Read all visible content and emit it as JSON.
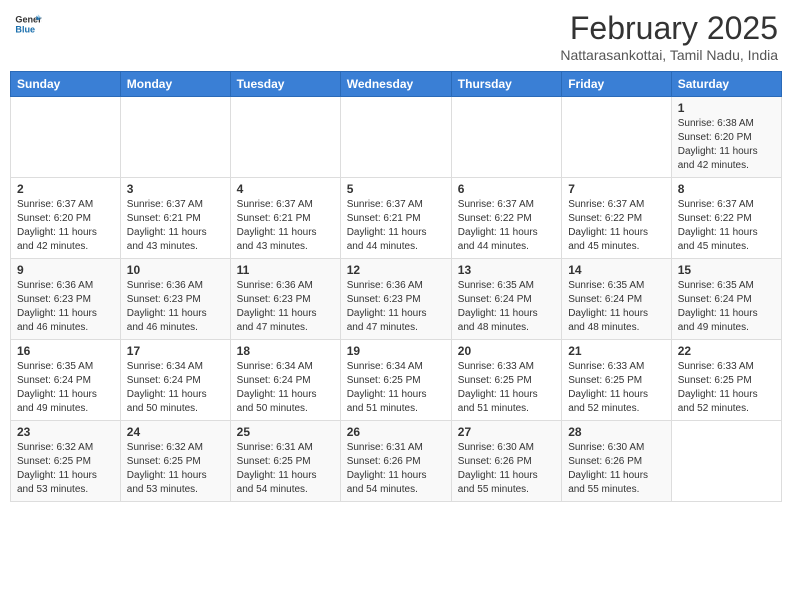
{
  "header": {
    "logo_line1": "General",
    "logo_line2": "Blue",
    "month_title": "February 2025",
    "location": "Nattarasankottai, Tamil Nadu, India"
  },
  "days_of_week": [
    "Sunday",
    "Monday",
    "Tuesday",
    "Wednesday",
    "Thursday",
    "Friday",
    "Saturday"
  ],
  "weeks": [
    [
      {
        "num": "",
        "info": ""
      },
      {
        "num": "",
        "info": ""
      },
      {
        "num": "",
        "info": ""
      },
      {
        "num": "",
        "info": ""
      },
      {
        "num": "",
        "info": ""
      },
      {
        "num": "",
        "info": ""
      },
      {
        "num": "1",
        "info": "Sunrise: 6:38 AM\nSunset: 6:20 PM\nDaylight: 11 hours\nand 42 minutes."
      }
    ],
    [
      {
        "num": "2",
        "info": "Sunrise: 6:37 AM\nSunset: 6:20 PM\nDaylight: 11 hours\nand 42 minutes."
      },
      {
        "num": "3",
        "info": "Sunrise: 6:37 AM\nSunset: 6:21 PM\nDaylight: 11 hours\nand 43 minutes."
      },
      {
        "num": "4",
        "info": "Sunrise: 6:37 AM\nSunset: 6:21 PM\nDaylight: 11 hours\nand 43 minutes."
      },
      {
        "num": "5",
        "info": "Sunrise: 6:37 AM\nSunset: 6:21 PM\nDaylight: 11 hours\nand 44 minutes."
      },
      {
        "num": "6",
        "info": "Sunrise: 6:37 AM\nSunset: 6:22 PM\nDaylight: 11 hours\nand 44 minutes."
      },
      {
        "num": "7",
        "info": "Sunrise: 6:37 AM\nSunset: 6:22 PM\nDaylight: 11 hours\nand 45 minutes."
      },
      {
        "num": "8",
        "info": "Sunrise: 6:37 AM\nSunset: 6:22 PM\nDaylight: 11 hours\nand 45 minutes."
      }
    ],
    [
      {
        "num": "9",
        "info": "Sunrise: 6:36 AM\nSunset: 6:23 PM\nDaylight: 11 hours\nand 46 minutes."
      },
      {
        "num": "10",
        "info": "Sunrise: 6:36 AM\nSunset: 6:23 PM\nDaylight: 11 hours\nand 46 minutes."
      },
      {
        "num": "11",
        "info": "Sunrise: 6:36 AM\nSunset: 6:23 PM\nDaylight: 11 hours\nand 47 minutes."
      },
      {
        "num": "12",
        "info": "Sunrise: 6:36 AM\nSunset: 6:23 PM\nDaylight: 11 hours\nand 47 minutes."
      },
      {
        "num": "13",
        "info": "Sunrise: 6:35 AM\nSunset: 6:24 PM\nDaylight: 11 hours\nand 48 minutes."
      },
      {
        "num": "14",
        "info": "Sunrise: 6:35 AM\nSunset: 6:24 PM\nDaylight: 11 hours\nand 48 minutes."
      },
      {
        "num": "15",
        "info": "Sunrise: 6:35 AM\nSunset: 6:24 PM\nDaylight: 11 hours\nand 49 minutes."
      }
    ],
    [
      {
        "num": "16",
        "info": "Sunrise: 6:35 AM\nSunset: 6:24 PM\nDaylight: 11 hours\nand 49 minutes."
      },
      {
        "num": "17",
        "info": "Sunrise: 6:34 AM\nSunset: 6:24 PM\nDaylight: 11 hours\nand 50 minutes."
      },
      {
        "num": "18",
        "info": "Sunrise: 6:34 AM\nSunset: 6:24 PM\nDaylight: 11 hours\nand 50 minutes."
      },
      {
        "num": "19",
        "info": "Sunrise: 6:34 AM\nSunset: 6:25 PM\nDaylight: 11 hours\nand 51 minutes."
      },
      {
        "num": "20",
        "info": "Sunrise: 6:33 AM\nSunset: 6:25 PM\nDaylight: 11 hours\nand 51 minutes."
      },
      {
        "num": "21",
        "info": "Sunrise: 6:33 AM\nSunset: 6:25 PM\nDaylight: 11 hours\nand 52 minutes."
      },
      {
        "num": "22",
        "info": "Sunrise: 6:33 AM\nSunset: 6:25 PM\nDaylight: 11 hours\nand 52 minutes."
      }
    ],
    [
      {
        "num": "23",
        "info": "Sunrise: 6:32 AM\nSunset: 6:25 PM\nDaylight: 11 hours\nand 53 minutes."
      },
      {
        "num": "24",
        "info": "Sunrise: 6:32 AM\nSunset: 6:25 PM\nDaylight: 11 hours\nand 53 minutes."
      },
      {
        "num": "25",
        "info": "Sunrise: 6:31 AM\nSunset: 6:25 PM\nDaylight: 11 hours\nand 54 minutes."
      },
      {
        "num": "26",
        "info": "Sunrise: 6:31 AM\nSunset: 6:26 PM\nDaylight: 11 hours\nand 54 minutes."
      },
      {
        "num": "27",
        "info": "Sunrise: 6:30 AM\nSunset: 6:26 PM\nDaylight: 11 hours\nand 55 minutes."
      },
      {
        "num": "28",
        "info": "Sunrise: 6:30 AM\nSunset: 6:26 PM\nDaylight: 11 hours\nand 55 minutes."
      },
      {
        "num": "",
        "info": ""
      }
    ]
  ]
}
